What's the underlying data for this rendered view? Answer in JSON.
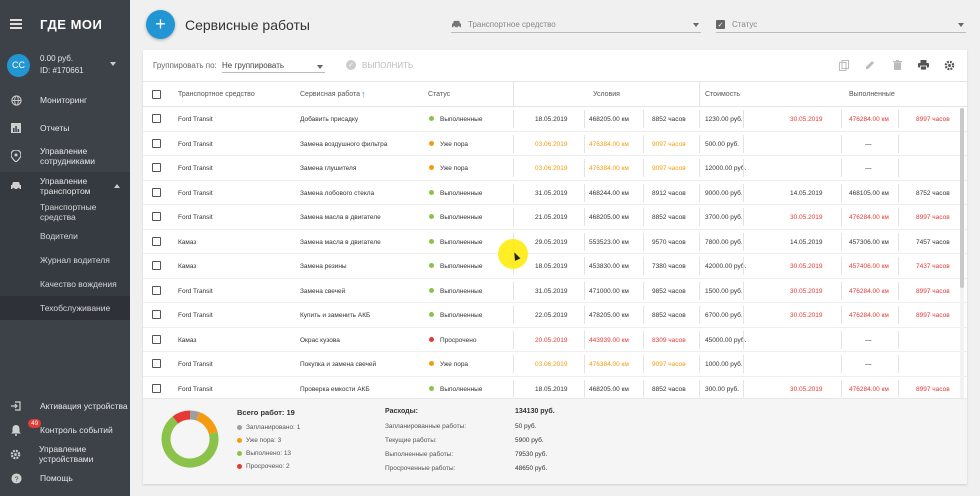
{
  "sidebar": {
    "logo": "ГДЕ МОИ",
    "user_balance": "0.00 руб.",
    "user_id": "ID: #170661",
    "avatar_initials": "CC",
    "items": [
      {
        "label": "Мониторинг",
        "icon": "globe-icon"
      },
      {
        "label": "Отчеты",
        "icon": "chart-icon"
      },
      {
        "label": "Управление сотрудниками",
        "icon": "location-pin-icon"
      },
      {
        "label": "Управление транспортом",
        "icon": "car-icon"
      }
    ],
    "sub_items": [
      "Транспортные средства",
      "Водители",
      "Журнал водителя",
      "Качество вождения",
      "Техобслуживание"
    ],
    "bottom_items": [
      {
        "label": "Активация устройства",
        "icon": "login-icon"
      },
      {
        "label": "Контроль событий",
        "icon": "bell-icon",
        "badge": "49"
      },
      {
        "label": "Управление устройствами",
        "icon": "gear-icon"
      },
      {
        "label": "Помощь",
        "icon": "help-icon"
      }
    ]
  },
  "header": {
    "add_label": "+",
    "title": "Сервисные работы",
    "vehicle_filter_placeholder": "Транспортное средство",
    "status_filter_label": "Статус"
  },
  "toolbar": {
    "group_label": "Группировать по:",
    "group_value": "Не группировать",
    "execute_label": "ВЫПОЛНИТЬ"
  },
  "table": {
    "headers": {
      "vehicle": "Транспортное средство",
      "service": "Сервисная работа",
      "status": "Статус",
      "conditions": "Условия",
      "cost": "Стоимость",
      "completed": "Выполненные"
    },
    "rows": [
      {
        "vehicle": "Ford Transit",
        "service": "Добавить присадку",
        "status": "Выполненные",
        "status_color": "#8bc34a",
        "cond_date": "18.05.2019",
        "cond_km": "468205.00 км",
        "cond_hours": "8852 часов",
        "cond_style": "",
        "cost": "1230.00 руб.",
        "done_date": "30.05.2019",
        "done_km": "476284.00 км",
        "done_hours": "8997 часов",
        "done_style": "red"
      },
      {
        "vehicle": "Ford Transit",
        "service": "Замена воздушного фильтра",
        "status": "Уже пора",
        "status_color": "#f39c12",
        "cond_date": "03.06.2019",
        "cond_km": "476384.00 км",
        "cond_hours": "9097 часов",
        "cond_style": "orange",
        "cost": "500.00 руб.",
        "done_date": "",
        "done_km": "—",
        "done_hours": "",
        "done_style": ""
      },
      {
        "vehicle": "Ford Transit",
        "service": "Замена глушителя",
        "status": "Уже пора",
        "status_color": "#f39c12",
        "cond_date": "03.06.2019",
        "cond_km": "476384.00 км",
        "cond_hours": "9097 часов",
        "cond_style": "orange",
        "cost": "12000.00 руб.",
        "done_date": "",
        "done_km": "—",
        "done_hours": "",
        "done_style": ""
      },
      {
        "vehicle": "Ford Transit",
        "service": "Замена лобового стекла",
        "status": "Выполненные",
        "status_color": "#8bc34a",
        "cond_date": "31.05.2019",
        "cond_km": "468244.00 км",
        "cond_hours": "8912 часов",
        "cond_style": "",
        "cost": "9000.00 руб.",
        "done_date": "14.05.2019",
        "done_km": "468105.00 км",
        "done_hours": "8752 часов",
        "done_style": ""
      },
      {
        "vehicle": "Ford Transit",
        "service": "Замена масла в двигателе",
        "status": "Выполненные",
        "status_color": "#8bc34a",
        "cond_date": "21.05.2019",
        "cond_km": "468205.00 км",
        "cond_hours": "8852 часов",
        "cond_style": "",
        "cost": "3700.00 руб.",
        "done_date": "30.05.2019",
        "done_km": "476284.00 км",
        "done_hours": "8997 часов",
        "done_style": "red"
      },
      {
        "vehicle": "Камаз",
        "service": "Замена масла в двигателе",
        "status": "Выполненные",
        "status_color": "#8bc34a",
        "cond_date": "29.05.2019",
        "cond_km": "553523.00 км",
        "cond_hours": "9570 часов",
        "cond_style": "",
        "cost": "7800.00 руб.",
        "done_date": "14.05.2019",
        "done_km": "457306.00 км",
        "done_hours": "7457 часов",
        "done_style": ""
      },
      {
        "vehicle": "Камаз",
        "service": "Замена резины",
        "status": "Выполненные",
        "status_color": "#8bc34a",
        "cond_date": "18.05.2019",
        "cond_km": "453830.00 км",
        "cond_hours": "7380 часов",
        "cond_style": "",
        "cost": "42000.00 руб.",
        "done_date": "30.05.2019",
        "done_km": "457406.00 км",
        "done_hours": "7437 часов",
        "done_style": "red"
      },
      {
        "vehicle": "Ford Transit",
        "service": "Замена свечей",
        "status": "Выполненные",
        "status_color": "#8bc34a",
        "cond_date": "31.05.2019",
        "cond_km": "471000.00 км",
        "cond_hours": "9852 часов",
        "cond_style": "",
        "cost": "1500.00 руб.",
        "done_date": "30.05.2019",
        "done_km": "476284.00 км",
        "done_hours": "8997 часов",
        "done_style": "red"
      },
      {
        "vehicle": "Ford Transit",
        "service": "Купить и заменить АКБ",
        "status": "Выполненные",
        "status_color": "#8bc34a",
        "cond_date": "22.05.2019",
        "cond_km": "478205.00 км",
        "cond_hours": "8852 часов",
        "cond_style": "",
        "cost": "6700.00 руб.",
        "done_date": "30.05.2019",
        "done_km": "476284.00 км",
        "done_hours": "8997 часов",
        "done_style": "red"
      },
      {
        "vehicle": "Камаз",
        "service": "Окрас кузова",
        "status": "Просрочено",
        "status_color": "#e53935",
        "cond_date": "20.05.2019",
        "cond_km": "443939.00 км",
        "cond_hours": "8309 часов",
        "cond_style": "red",
        "cost": "45000.00 руб.",
        "done_date": "",
        "done_km": "—",
        "done_hours": "",
        "done_style": ""
      },
      {
        "vehicle": "Ford Transit",
        "service": "Покупка и замена свечей",
        "status": "Уже пора",
        "status_color": "#f39c12",
        "cond_date": "03.06.2019",
        "cond_km": "476384.00 км",
        "cond_hours": "9097 часов",
        "cond_style": "orange",
        "cost": "1000.00 руб.",
        "done_date": "",
        "done_km": "—",
        "done_hours": "",
        "done_style": ""
      },
      {
        "vehicle": "Ford Transit",
        "service": "Проверка емкости АКБ",
        "status": "Выполненные",
        "status_color": "#8bc34a",
        "cond_date": "18.05.2019",
        "cond_km": "468205.00 км",
        "cond_hours": "8852 часов",
        "cond_style": "",
        "cost": "300.00 руб.",
        "done_date": "30.05.2019",
        "done_km": "476284.00 км",
        "done_hours": "8997 часов",
        "done_style": "red"
      }
    ]
  },
  "summary": {
    "total_label": "Всего работ: 19",
    "legend": [
      {
        "label": "Запланировано: 1",
        "color": "#9e9e9e"
      },
      {
        "label": "Уже пора: 3",
        "color": "#f39c12"
      },
      {
        "label": "Выполнено: 13",
        "color": "#8bc34a"
      },
      {
        "label": "Просрочено: 2",
        "color": "#e53935"
      }
    ],
    "expenses": [
      {
        "label": "Расходы:",
        "value": "134130 руб."
      },
      {
        "label": "Запланированные работы:",
        "value": "50 руб."
      },
      {
        "label": "Текущие работы:",
        "value": "5900 руб."
      },
      {
        "label": "Выполненные работы:",
        "value": "79530 руб."
      },
      {
        "label": "Просроченные работы:",
        "value": "48650 руб."
      }
    ]
  },
  "chart_data": {
    "type": "pie",
    "categories": [
      "Запланировано",
      "Уже пора",
      "Выполнено",
      "Просрочено"
    ],
    "values": [
      1,
      3,
      13,
      2
    ],
    "colors": [
      "#9e9e9e",
      "#f39c12",
      "#8bc34a",
      "#e53935"
    ]
  }
}
